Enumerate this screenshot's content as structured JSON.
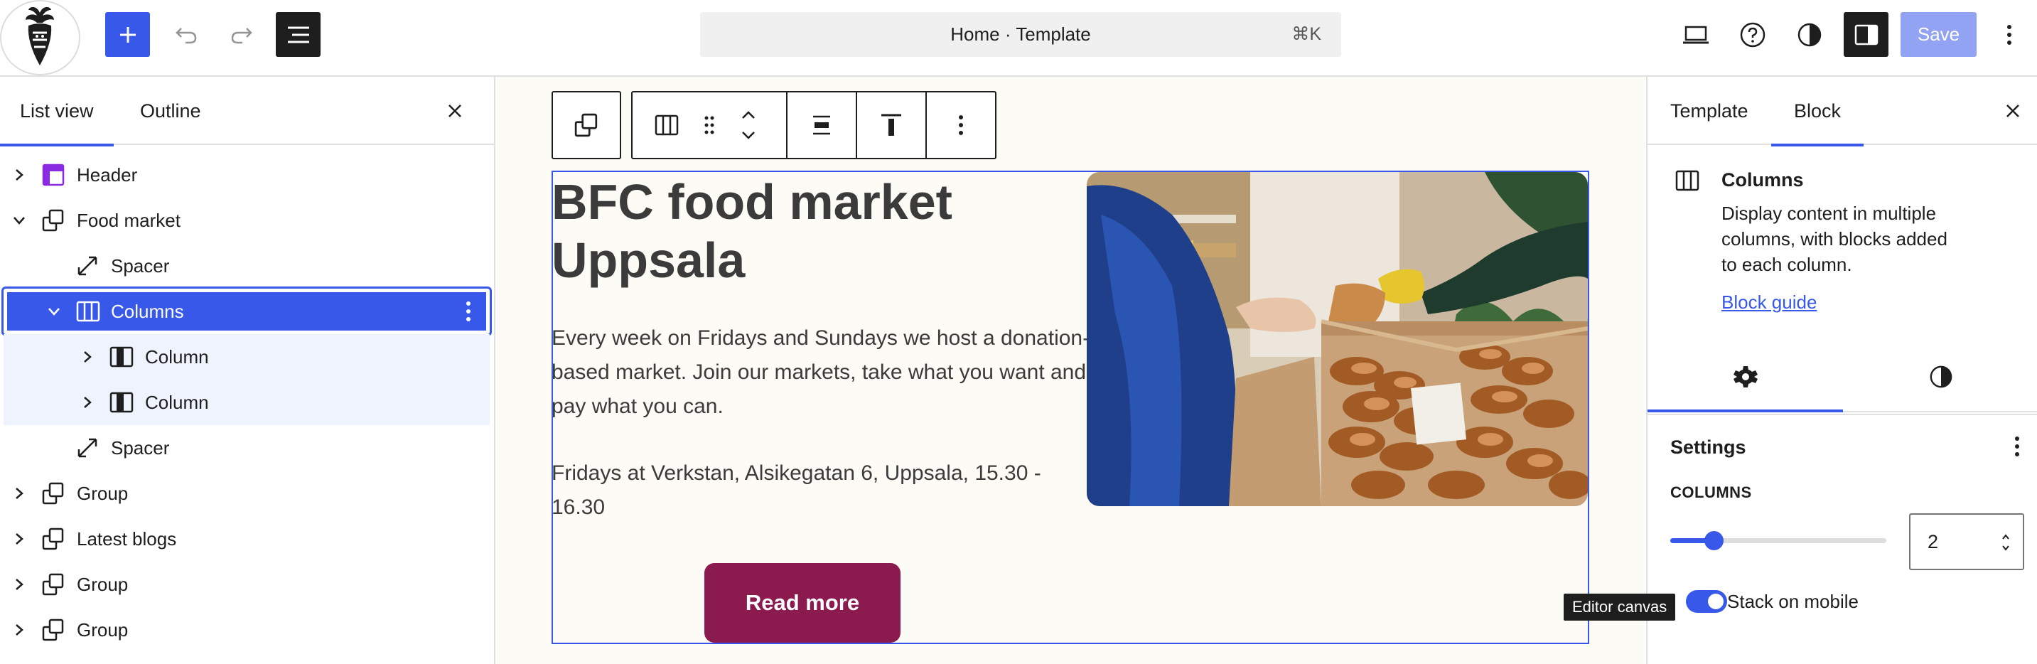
{
  "topbar": {
    "command_title": "Home · Template",
    "command_shortcut": "⌘K",
    "save_label": "Save",
    "icons": [
      "site-logo",
      "add-block-icon",
      "undo-icon",
      "redo-icon",
      "document-overview-icon",
      "view-device-icon",
      "help-icon",
      "styles-icon",
      "settings-sidebar-icon",
      "options-icon"
    ]
  },
  "list_panel": {
    "tabs": [
      "List view",
      "Outline"
    ],
    "active_tab": "List view",
    "items": [
      {
        "label": "Header",
        "icon": "template-part-icon",
        "expanded": false
      },
      {
        "label": "Food market",
        "icon": "group-icon",
        "expanded": true
      },
      {
        "label": "Spacer",
        "icon": "spacer-icon"
      },
      {
        "label": "Columns",
        "icon": "columns-icon",
        "expanded": true,
        "selected": true
      },
      {
        "label": "Column",
        "icon": "column-icon",
        "expanded": false
      },
      {
        "label": "Column",
        "icon": "column-icon",
        "expanded": false
      },
      {
        "label": "Spacer",
        "icon": "spacer-icon"
      },
      {
        "label": "Group",
        "icon": "group-icon",
        "expanded": false
      },
      {
        "label": "Latest blogs",
        "icon": "group-icon",
        "expanded": false
      },
      {
        "label": "Group",
        "icon": "group-icon",
        "expanded": false
      },
      {
        "label": "Group",
        "icon": "group-icon",
        "expanded": false
      }
    ]
  },
  "canvas": {
    "heading": "BFC food market Uppsala",
    "paragraph1": "Every week on Fridays and Sundays we host a donation-based market. Join our markets, take what you want and pay what you can.",
    "paragraph2": "Fridays at Verkstan, Alsikegatan 6, Uppsala, 15.30 - 16.30",
    "button_label": "Read more",
    "tooltip": "Editor canvas",
    "button_color": "#8b1a4e",
    "background_color": "#fdfbf6"
  },
  "inspector": {
    "tabs": [
      "Template",
      "Block"
    ],
    "active_tab": "Block",
    "block_name": "Columns",
    "block_description": "Display content in multiple columns, with blocks added to each column.",
    "block_guide_link": "Block guide",
    "settings_title": "Settings",
    "columns_label": "COLUMNS",
    "columns_value": "2",
    "columns_slider_fraction": 0.2,
    "stack_label": "Stack on mobile",
    "stack_enabled": true,
    "accent_color": "#3858e9"
  }
}
